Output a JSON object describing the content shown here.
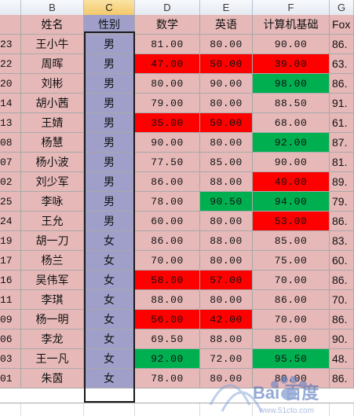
{
  "colors": {
    "cell_pink": "#e6b8b8",
    "cell_lavender": "#9f9fca",
    "cell_red": "#ff0000",
    "cell_green": "#00b050"
  },
  "columns": [
    "B",
    "C",
    "D",
    "E",
    "F",
    "G"
  ],
  "active_column": "C",
  "header": {
    "id": "",
    "name": "姓名",
    "gender": "性别",
    "math": "数学",
    "english": "英语",
    "computer": "计算机基础",
    "fox": "Fox"
  },
  "rows": [
    {
      "id": "23",
      "name": "王小牛",
      "gender": "男",
      "math": "81.00",
      "english": "80.00",
      "computer": "90.00",
      "fox": "86.",
      "math_fill": "pink",
      "english_fill": "pink",
      "computer_fill": "pink"
    },
    {
      "id": "22",
      "name": "周晖",
      "gender": "男",
      "math": "47.00",
      "english": "50.00",
      "computer": "39.00",
      "fox": "63.",
      "math_fill": "red",
      "english_fill": "red",
      "computer_fill": "red"
    },
    {
      "id": "20",
      "name": "刘彬",
      "gender": "男",
      "math": "80.00",
      "english": "90.00",
      "computer": "98.00",
      "fox": "86.",
      "math_fill": "pink",
      "english_fill": "pink",
      "computer_fill": "green"
    },
    {
      "id": "14",
      "name": "胡小茜",
      "gender": "男",
      "math": "79.00",
      "english": "80.00",
      "computer": "88.50",
      "fox": "91.",
      "math_fill": "pink",
      "english_fill": "pink",
      "computer_fill": "pink"
    },
    {
      "id": "13",
      "name": "王婧",
      "gender": "男",
      "math": "35.00",
      "english": "50.00",
      "computer": "68.00",
      "fox": "61.",
      "math_fill": "red",
      "english_fill": "red",
      "computer_fill": "pink"
    },
    {
      "id": "08",
      "name": "杨慧",
      "gender": "男",
      "math": "90.00",
      "english": "80.00",
      "computer": "92.00",
      "fox": "87.",
      "math_fill": "pink",
      "english_fill": "pink",
      "computer_fill": "green"
    },
    {
      "id": "07",
      "name": "杨小波",
      "gender": "男",
      "math": "77.50",
      "english": "85.00",
      "computer": "90.00",
      "fox": "81.",
      "math_fill": "pink",
      "english_fill": "pink",
      "computer_fill": "pink"
    },
    {
      "id": "02",
      "name": "刘少军",
      "gender": "男",
      "math": "86.00",
      "english": "88.00",
      "computer": "49.00",
      "fox": "89.",
      "math_fill": "pink",
      "english_fill": "pink",
      "computer_fill": "red"
    },
    {
      "id": "25",
      "name": "李咏",
      "gender": "男",
      "math": "78.00",
      "english": "90.50",
      "computer": "94.00",
      "fox": "79.",
      "math_fill": "pink",
      "english_fill": "green",
      "computer_fill": "green"
    },
    {
      "id": "24",
      "name": "王允",
      "gender": "男",
      "math": "60.00",
      "english": "80.00",
      "computer": "53.00",
      "fox": "86.",
      "math_fill": "pink",
      "english_fill": "pink",
      "computer_fill": "red"
    },
    {
      "id": "19",
      "name": "胡一刀",
      "gender": "女",
      "math": "86.00",
      "english": "88.00",
      "computer": "85.00",
      "fox": "83.",
      "math_fill": "pink",
      "english_fill": "pink",
      "computer_fill": "pink"
    },
    {
      "id": "17",
      "name": "杨兰",
      "gender": "女",
      "math": "70.00",
      "english": "80.00",
      "computer": "75.00",
      "fox": "60.",
      "math_fill": "pink",
      "english_fill": "pink",
      "computer_fill": "pink"
    },
    {
      "id": "16",
      "name": "吴伟军",
      "gender": "女",
      "math": "58.00",
      "english": "57.00",
      "computer": "70.00",
      "fox": "86.",
      "math_fill": "red",
      "english_fill": "red",
      "computer_fill": "pink"
    },
    {
      "id": "11",
      "name": "李琪",
      "gender": "女",
      "math": "88.00",
      "english": "80.00",
      "computer": "86.00",
      "fox": "70.",
      "math_fill": "pink",
      "english_fill": "pink",
      "computer_fill": "pink"
    },
    {
      "id": "09",
      "name": "杨一明",
      "gender": "女",
      "math": "56.00",
      "english": "42.00",
      "computer": "70.00",
      "fox": "86.",
      "math_fill": "red",
      "english_fill": "red",
      "computer_fill": "pink"
    },
    {
      "id": "06",
      "name": "李龙",
      "gender": "女",
      "math": "69.50",
      "english": "88.00",
      "computer": "85.00",
      "fox": "90.",
      "math_fill": "pink",
      "english_fill": "pink",
      "computer_fill": "pink"
    },
    {
      "id": "03",
      "name": "王一凡",
      "gender": "女",
      "math": "92.00",
      "english": "72.00",
      "computer": "95.50",
      "fox": "48.",
      "math_fill": "green",
      "english_fill": "pink",
      "computer_fill": "green"
    },
    {
      "id": "01",
      "name": "朱茵",
      "gender": "女",
      "math": "78.00",
      "english": "80.00",
      "computer": "80.00",
      "fox": "86.",
      "math_fill": "pink",
      "english_fill": "pink",
      "computer_fill": "pink"
    }
  ],
  "watermark": {
    "logo": "Bai 百度",
    "site": "www.51cto.com"
  }
}
